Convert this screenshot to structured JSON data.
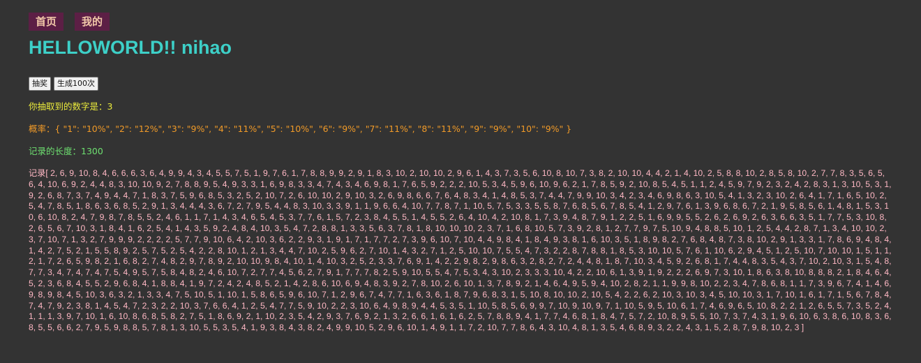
{
  "nav": {
    "home": "首页",
    "mine": "我的"
  },
  "title": "HELLOWORLD!! nihao",
  "buttons": {
    "draw": "抽奖",
    "generate100": "生成100次"
  },
  "result": {
    "label": "你抽取到的数字是：",
    "value": "3"
  },
  "probability": {
    "label": "概率：",
    "value": "{ \"1\": \"10%\", \"2\": \"12%\", \"3\": \"9%\", \"4\": \"11%\", \"5\": \"10%\", \"6\": \"9%\", \"7\": \"11%\", \"8\": \"11%\", \"9\": \"9%\", \"10\": \"9%\" }"
  },
  "record_length": {
    "label": "记录的长度：",
    "value": "1300"
  },
  "record": {
    "label": "记录",
    "values": "[ 2, 6, 9, 10, 8, 4, 6, 6, 6, 3, 6, 4, 9, 9, 4, 3, 4, 5, 5, 7, 5, 1, 9, 7, 6, 1, 7, 8, 8, 9, 9, 2, 9, 1, 8, 3, 10, 2, 10, 10, 2, 9, 6, 1, 4, 3, 7, 3, 5, 6, 10, 8, 10, 7, 3, 8, 2, 10, 10, 4, 4, 2, 1, 4, 10, 2, 5, 8, 8, 10, 2, 8, 5, 8, 10, 2, 7, 7, 8, 3, 5, 6, 5, 6, 4, 10, 6, 9, 2, 4, 4, 8, 3, 10, 10, 9, 2, 7, 8, 8, 9, 5, 4, 9, 3, 3, 1, 6, 9, 8, 3, 3, 4, 7, 4, 3, 4, 6, 9, 8, 1, 7, 6, 5, 9, 2, 2, 2, 10, 5, 3, 4, 5, 9, 6, 10, 9, 6, 2, 1, 7, 8, 5, 9, 2, 10, 8, 5, 4, 5, 1, 1, 2, 4, 5, 9, 7, 9, 2, 3, 2, 4, 2, 8, 3, 1, 3, 10, 5, 3, 1, 9, 2, 6, 8, 7, 3, 7, 4, 9, 4, 4, 7, 1, 8, 3, 7, 5, 9, 6, 8, 5, 3, 2, 5, 2, 10, 7, 2, 6, 10, 10, 2, 9, 10, 3, 2, 6, 9, 8, 6, 6, 7, 6, 4, 8, 3, 4, 1, 4, 8, 5, 3, 7, 4, 4, 7, 9, 9, 10, 3, 4, 2, 3, 4, 6, 9, 8, 6, 3, 10, 5, 4, 1, 3, 2, 3, 10, 2, 6, 4, 1, 7, 1, 6, 5, 10, 2, 5, 4, 7, 8, 5, 1, 8, 6, 3, 6, 8, 5, 2, 9, 1, 3, 4, 4, 4, 3, 6, 7, 2, 7, 9, 5, 4, 4, 8, 3, 10, 3, 3, 9, 1, 1, 9, 6, 6, 4, 10, 7, 7, 8, 7, 1, 10, 5, 7, 5, 3, 3, 5, 5, 8, 7, 6, 8, 5, 6, 7, 8, 5, 4, 1, 2, 9, 7, 6, 1, 3, 9, 6, 8, 6, 7, 2, 1, 9, 5, 8, 5, 6, 1, 4, 8, 1, 5, 3, 10, 6, 10, 8, 2, 4, 7, 9, 8, 7, 8, 5, 5, 2, 4, 6, 1, 1, 7, 1, 4, 3, 4, 6, 5, 4, 5, 3, 7, 7, 6, 1, 5, 7, 2, 3, 8, 4, 5, 5, 1, 4, 5, 5, 2, 6, 4, 10, 4, 2, 10, 8, 1, 7, 3, 9, 4, 8, 7, 9, 1, 2, 2, 5, 1, 6, 9, 9, 5, 5, 2, 6, 2, 6, 9, 2, 6, 3, 6, 6, 3, 5, 1, 7, 7, 5, 3, 10, 8, 2, 6, 5, 6, 7, 10, 3, 1, 8, 4, 1, 6, 2, 5, 4, 1, 4, 3, 5, 9, 2, 4, 8, 4, 10, 3, 5, 4, 7, 2, 8, 8, 1, 3, 3, 5, 6, 3, 7, 8, 1, 8, 10, 10, 10, 2, 3, 7, 1, 6, 8, 10, 5, 7, 3, 9, 2, 8, 1, 2, 7, 7, 9, 7, 5, 10, 9, 4, 8, 8, 5, 10, 1, 2, 5, 4, 4, 2, 8, 7, 1, 3, 4, 10, 10, 2, 3, 7, 10, 7, 1, 3, 2, 7, 9, 9, 9, 2, 2, 2, 2, 5, 7, 7, 9, 10, 6, 4, 2, 10, 3, 6, 2, 2, 9, 3, 1, 9, 1, 7, 1, 7, 7, 2, 7, 3, 9, 6, 10, 7, 10, 4, 4, 9, 8, 4, 1, 8, 4, 9, 3, 8, 1, 6, 10, 3, 5, 1, 8, 9, 8, 2, 7, 6, 8, 4, 8, 7, 3, 8, 10, 2, 9, 1, 3, 3, 1, 7, 8, 6, 9, 4, 8, 4, 1, 4, 2, 7, 5, 2, 1, 5, 5, 8, 9, 2, 5, 7, 5, 2, 5, 4, 2, 2, 8, 10, 1, 2, 1, 3, 4, 4, 7, 10, 2, 5, 9, 6, 2, 7, 10, 1, 4, 3, 2, 7, 1, 2, 5, 10, 10, 7, 5, 5, 4, 7, 3, 2, 2, 8, 7, 8, 8, 1, 8, 5, 3, 10, 10, 5, 7, 6, 1, 10, 6, 2, 9, 4, 5, 1, 2, 5, 10, 7, 10, 10, 1, 5, 1, 1, 2, 1, 7, 2, 6, 5, 9, 8, 2, 1, 6, 8, 2, 7, 4, 8, 2, 9, 7, 8, 9, 2, 10, 10, 9, 8, 4, 10, 1, 4, 10, 3, 2, 5, 2, 3, 3, 7, 6, 9, 1, 4, 2, 2, 9, 8, 2, 9, 8, 6, 3, 2, 8, 2, 7, 2, 4, 4, 8, 1, 8, 7, 10, 3, 4, 5, 9, 2, 6, 8, 1, 7, 4, 4, 8, 3, 5, 4, 3, 7, 10, 2, 10, 3, 1, 5, 4, 8, 7, 7, 3, 4, 7, 4, 7, 4, 7, 5, 4, 9, 5, 7, 5, 8, 4, 8, 2, 4, 6, 10, 7, 2, 7, 7, 4, 5, 6, 2, 7, 9, 1, 7, 7, 7, 8, 2, 5, 9, 10, 5, 5, 4, 7, 5, 3, 4, 3, 10, 2, 3, 3, 3, 10, 4, 2, 2, 10, 6, 1, 3, 9, 1, 9, 2, 2, 2, 6, 9, 7, 3, 10, 1, 8, 6, 3, 8, 10, 8, 8, 8, 2, 1, 8, 4, 6, 4, 5, 2, 3, 6, 8, 4, 5, 5, 2, 9, 6, 8, 4, 1, 8, 8, 4, 1, 9, 7, 2, 4, 2, 4, 8, 5, 2, 1, 4, 2, 8, 6, 10, 6, 9, 4, 8, 3, 9, 2, 7, 8, 10, 2, 6, 10, 1, 3, 7, 8, 9, 2, 1, 4, 6, 4, 9, 5, 9, 4, 10, 2, 8, 2, 1, 1, 9, 9, 8, 10, 2, 2, 3, 4, 7, 8, 6, 8, 1, 1, 7, 3, 9, 6, 7, 4, 1, 4, 6, 9, 8, 9, 8, 4, 5, 10, 3, 6, 3, 2, 1, 3, 3, 4, 7, 5, 10, 5, 1, 10, 1, 5, 8, 6, 5, 9, 6, 10, 7, 1, 2, 9, 6, 7, 4, 7, 7, 1, 6, 3, 6, 1, 8, 7, 9, 6, 8, 3, 1, 5, 10, 8, 10, 10, 2, 10, 5, 4, 2, 2, 6, 2, 10, 3, 10, 3, 4, 5, 10, 10, 3, 1, 7, 10, 1, 6, 1, 7, 1, 5, 6, 7, 8, 4, 7, 4, 7, 9, 2, 3, 8, 1, 4, 5, 4, 7, 2, 3, 2, 2, 10, 3, 7, 6, 6, 4, 1, 2, 5, 4, 7, 7, 5, 9, 10, 2, 2, 3, 10, 6, 4, 9, 8, 9, 4, 4, 5, 3, 5, 1, 10, 5, 8, 5, 6, 9, 9, 7, 10, 9, 10, 9, 7, 1, 10, 5, 9, 5, 10, 6, 1, 7, 4, 6, 9, 6, 5, 10, 8, 2, 2, 1, 2, 6, 5, 5, 7, 3, 5, 2, 4, 1, 1, 1, 3, 9, 7, 10, 1, 6, 10, 8, 6, 8, 5, 8, 2, 7, 5, 1, 8, 6, 9, 2, 1, 10, 2, 3, 5, 4, 2, 9, 3, 7, 6, 9, 2, 1, 3, 2, 6, 6, 1, 6, 1, 6, 2, 5, 7, 8, 8, 9, 4, 1, 7, 7, 4, 6, 8, 1, 8, 4, 7, 5, 7, 2, 10, 8, 9, 5, 5, 10, 7, 3, 7, 4, 3, 1, 9, 6, 10, 6, 3, 8, 6, 10, 8, 3, 6, 8, 5, 5, 6, 6, 2, 7, 9, 5, 9, 8, 8, 5, 7, 8, 1, 3, 10, 5, 5, 3, 5, 4, 1, 9, 3, 8, 4, 3, 8, 2, 4, 9, 9, 10, 5, 2, 9, 6, 10, 1, 4, 9, 1, 1, 7, 2, 10, 7, 7, 8, 6, 4, 3, 10, 4, 8, 1, 3, 5, 4, 6, 8, 9, 3, 2, 2, 4, 3, 1, 5, 2, 8, 7, 9, 8, 10, 2, 3 ]"
  }
}
